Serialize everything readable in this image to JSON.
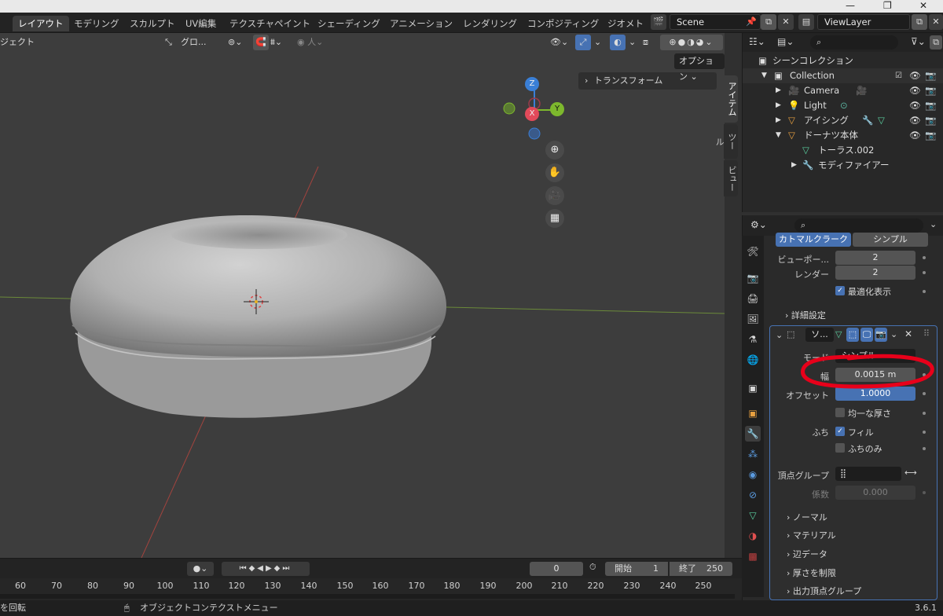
{
  "window": {
    "minimize": "—",
    "restore": "❐",
    "close": "✕"
  },
  "workspaces": [
    {
      "label": "レイアウト",
      "active": true
    },
    {
      "label": "モデリング"
    },
    {
      "label": "スカルプト"
    },
    {
      "label": "UV編集"
    },
    {
      "label": "テクスチャペイント"
    },
    {
      "label": "シェーディング"
    },
    {
      "label": "アニメーション"
    },
    {
      "label": "レンダリング"
    },
    {
      "label": "コンポジティング"
    },
    {
      "label": "ジオメト"
    }
  ],
  "scene": {
    "name": "Scene"
  },
  "viewlayer": {
    "name": "ViewLayer"
  },
  "viewport": {
    "mode": "ジェクト",
    "transform_orientation": "グロ...",
    "options": "オプション",
    "transform_panel": "トランスフォーム",
    "gizmo": {
      "z": "Z",
      "y": "Y",
      "x": "X"
    },
    "sidetabs": [
      "アイテム",
      "ツール",
      "ビュー"
    ]
  },
  "outliner": {
    "root": "シーンコレクション",
    "items": [
      {
        "label": "Collection"
      },
      {
        "label": "Camera"
      },
      {
        "label": "Light"
      },
      {
        "label": "アイシング"
      },
      {
        "label": "ドーナツ本体"
      },
      {
        "label": "トーラス.002"
      },
      {
        "label": "モディファイアー"
      }
    ]
  },
  "properties": {
    "subdiv": {
      "tab_catmull": "カトマルクラーク",
      "tab_simple": "シンプル",
      "viewport_label": "ビューポー...",
      "viewport_value": "2",
      "render_label": "レンダー",
      "render_value": "2",
      "optimal_display": "最適化表示",
      "advanced": "詳細設定"
    },
    "solidify": {
      "name": "ソ...",
      "mode_label": "モード",
      "mode_value": "シンプル",
      "width_label": "幅",
      "width_value": "0.0015 m",
      "offset_label": "オフセット",
      "offset_value": "1.0000",
      "even_thickness": "均一な厚さ",
      "rim_label": "ふち",
      "fill": "フィル",
      "rim_only": "ふちのみ",
      "vgroup_label": "頂点グループ",
      "factor_label": "係数",
      "factor_value": "0.000",
      "sections": [
        "ノーマル",
        "マテリアル",
        "辺データ",
        "厚さを制限",
        "出力頂点グループ"
      ]
    }
  },
  "timeline": {
    "current_frame": "0",
    "start_label": "開始",
    "start_value": "1",
    "end_label": "終了",
    "end_value": "250",
    "ruler": [
      "60",
      "70",
      "80",
      "90",
      "100",
      "110",
      "120",
      "130",
      "140",
      "150",
      "160",
      "170",
      "180",
      "190",
      "200",
      "210",
      "220",
      "230",
      "240",
      "250"
    ]
  },
  "status": {
    "left": "を回転",
    "context_menu": "オブジェクトコンテクストメニュー",
    "version": "3.6.1"
  },
  "colors": {
    "accent": "#4772b3",
    "annotation": "#e8001a"
  }
}
